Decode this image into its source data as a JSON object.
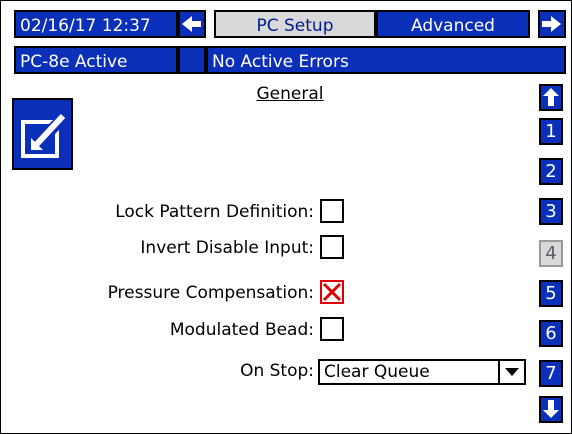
{
  "header": {
    "datetime": "02/16/17 12:37",
    "title": "PC Setup",
    "tab_advanced": "Advanced",
    "status": "PC-8e Active",
    "errors": "No Active Errors"
  },
  "main": {
    "section_title": "General",
    "settings": [
      {
        "label": "Lock Pattern Definition:",
        "checked": false
      },
      {
        "label": "Invert Disable Input:",
        "checked": false
      },
      {
        "label": "Pressure Compensation:",
        "checked": true
      },
      {
        "label": "Modulated Bead:",
        "checked": false
      }
    ],
    "on_stop": {
      "label": "On Stop:",
      "value": "Clear Queue"
    }
  },
  "side_tabs": [
    "1",
    "2",
    "3",
    "4",
    "5",
    "6",
    "7"
  ],
  "active_tab": "4",
  "icons": {
    "left": "left-arrow-icon",
    "right": "right-arrow-icon",
    "up": "up-arrow-icon",
    "down": "down-arrow-icon",
    "edit": "edit-icon",
    "dropdown": "dropdown-arrow-icon"
  },
  "colors": {
    "accent": "#0a2fb8",
    "alert": "#e00000"
  }
}
